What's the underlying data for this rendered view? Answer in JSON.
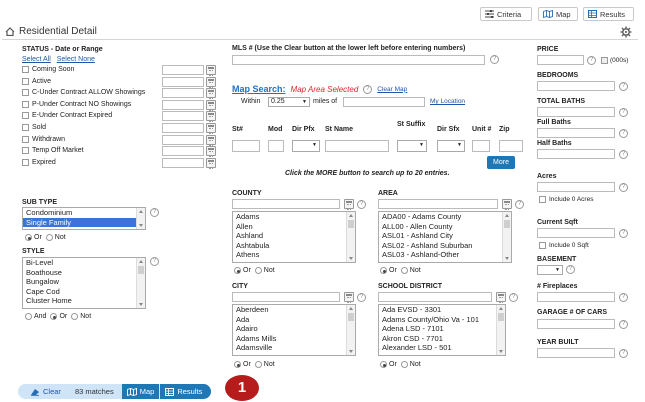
{
  "top_buttons": {
    "criteria": "Criteria",
    "map": "Map",
    "results": "Results"
  },
  "header": {
    "title": "Residential Detail"
  },
  "status": {
    "heading": "STATUS - Date or Range",
    "select_all": "Select All",
    "select_none": "Select None",
    "items": [
      "Coming Soon",
      "Active",
      "C-Under Contract ALLOW Showings",
      "P-Under Contract NO Showings",
      "E-Under Contract Expired",
      "Sold",
      "Withdrawn",
      "Temp Off Market",
      "Expired"
    ]
  },
  "subtype": {
    "heading": "SUB TYPE",
    "items": [
      "Condominium",
      "Single Family"
    ],
    "selected": "Single Family",
    "or": "Or",
    "not": "Not"
  },
  "style": {
    "heading": "STYLE",
    "items": [
      "Bi-Level",
      "Boathouse",
      "Bungalow",
      "Cape Cod",
      "Cluster Home"
    ],
    "and": "And",
    "or": "Or",
    "not": "Not"
  },
  "mls": {
    "label": "MLS # (Use the Clear button at the lower left before entering numbers)"
  },
  "map_search": {
    "title": "Map Search:",
    "selected": "Map Area Selected",
    "clear": "Clear Map",
    "within_label": "Within",
    "within_value": "0.25",
    "miles_of": "miles of",
    "my_location": "My Location"
  },
  "street": {
    "cols": [
      "St#",
      "Mod",
      "Dir Pfx",
      "St Name",
      "St Suffix",
      "Dir Sfx",
      "Unit #",
      "Zip"
    ],
    "more": "More",
    "note": "Click the MORE button to search up to 20 entries."
  },
  "county": {
    "heading": "COUNTY",
    "items": [
      "Adams",
      "Allen",
      "Ashland",
      "Ashtabula",
      "Athens"
    ],
    "or": "Or",
    "not": "Not"
  },
  "area": {
    "heading": "AREA",
    "items": [
      "ADA00 - Adams County",
      "ALL00 - Allen County",
      "ASL01 - Ashland City",
      "ASL02 - Ashland Suburban",
      "ASL03 - Ashland-Other"
    ],
    "or": "Or",
    "not": "Not"
  },
  "city": {
    "heading": "CITY",
    "items": [
      "Aberdeen",
      "Ada",
      "Adairo",
      "Adams Mills",
      "Adamsville"
    ],
    "or": "Or",
    "not": "Not"
  },
  "school": {
    "heading": "SCHOOL DISTRICT",
    "items": [
      "Ada EVSD - 3301",
      "Adams County/Ohio Va - 101",
      "Adena LSD - 7101",
      "Akron CSD - 7701",
      "Alexander LSD - 501"
    ],
    "or": "Or",
    "not": "Not"
  },
  "right": {
    "price": "PRICE",
    "thousands": "(000s)",
    "bedrooms": "BEDROOMS",
    "total_baths": "TOTAL BATHS",
    "full_baths": "Full Baths",
    "half_baths": "Half Baths",
    "acres": "Acres",
    "include_acres": "Include 0 Acres",
    "sqft": "Current Sqft",
    "include_sqft": "Include 0 Sqft",
    "basement": "BASEMENT",
    "fireplaces": "# Fireplaces",
    "garage": "GARAGE # OF CARS",
    "year_built": "YEAR BUILT"
  },
  "bottom": {
    "clear": "Clear",
    "matches": "83 matches",
    "map": "Map",
    "results": "Results",
    "badge": "1"
  },
  "colors": {
    "accent": "#1f77b4",
    "map_search": "#1a73c8",
    "map_selected": "#e0252b",
    "badge": "#b71c1c"
  }
}
